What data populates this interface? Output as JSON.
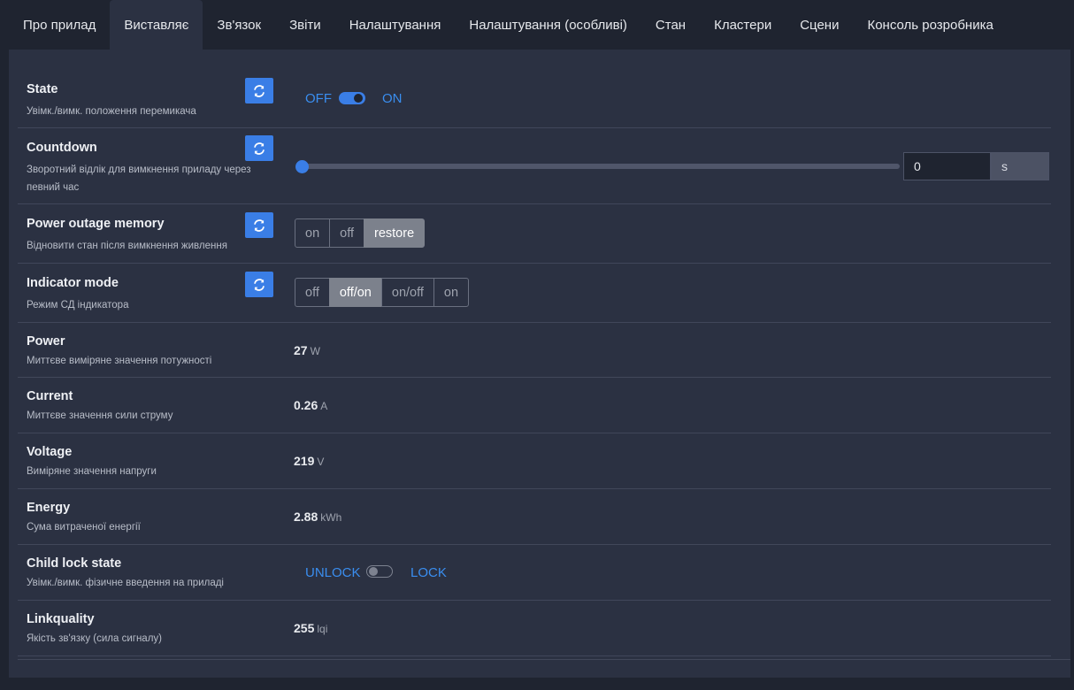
{
  "tabs": [
    {
      "label": "Про прилад"
    },
    {
      "label": "Виставляє"
    },
    {
      "label": "Зв'язок"
    },
    {
      "label": "Звіти"
    },
    {
      "label": "Налаштування"
    },
    {
      "label": "Налаштування (особливі)"
    },
    {
      "label": "Стан"
    },
    {
      "label": "Кластери"
    },
    {
      "label": "Сцени"
    },
    {
      "label": "Консоль розробника"
    }
  ],
  "active_tab": "Виставляє",
  "colors": {
    "accent": "#3a7ee6",
    "background": "#1f2430",
    "panel": "#2b3142"
  },
  "state": {
    "name": "State",
    "desc": "Увімк./вимк. положення перемикача",
    "off_label": "OFF",
    "on_label": "ON",
    "value": "ON"
  },
  "countdown": {
    "name": "Countdown",
    "desc": "Зворотний відлік для вимкнення приладу через певний час",
    "value": "0",
    "unit": "s",
    "slider_fraction": 0
  },
  "power_outage_memory": {
    "name": "Power outage memory",
    "desc": "Відновити стан після вимкнення живлення",
    "options": [
      "on",
      "off",
      "restore"
    ],
    "selected": "restore"
  },
  "indicator_mode": {
    "name": "Indicator mode",
    "desc": "Режим СД індикатора",
    "options": [
      "off",
      "off/on",
      "on/off",
      "on"
    ],
    "selected": "off/on"
  },
  "power": {
    "name": "Power",
    "desc": "Миттєве виміряне значення потужності",
    "value": "27",
    "unit": "W"
  },
  "current": {
    "name": "Current",
    "desc": "Миттєве значення сили струму",
    "value": "0.26",
    "unit": "A"
  },
  "voltage": {
    "name": "Voltage",
    "desc": "Виміряне значення напруги",
    "value": "219",
    "unit": "V"
  },
  "energy": {
    "name": "Energy",
    "desc": "Сума витраченої енергії",
    "value": "2.88",
    "unit": "kWh"
  },
  "child_lock": {
    "name": "Child lock state",
    "desc": "Увімк./вимк. фізичне введення на приладі",
    "off_label": "UNLOCK",
    "on_label": "LOCK",
    "value": "UNLOCK"
  },
  "linkquality": {
    "name": "Linkquality",
    "desc": "Якість зв'язку (сила сигналу)",
    "value": "255",
    "unit": "lqi"
  }
}
